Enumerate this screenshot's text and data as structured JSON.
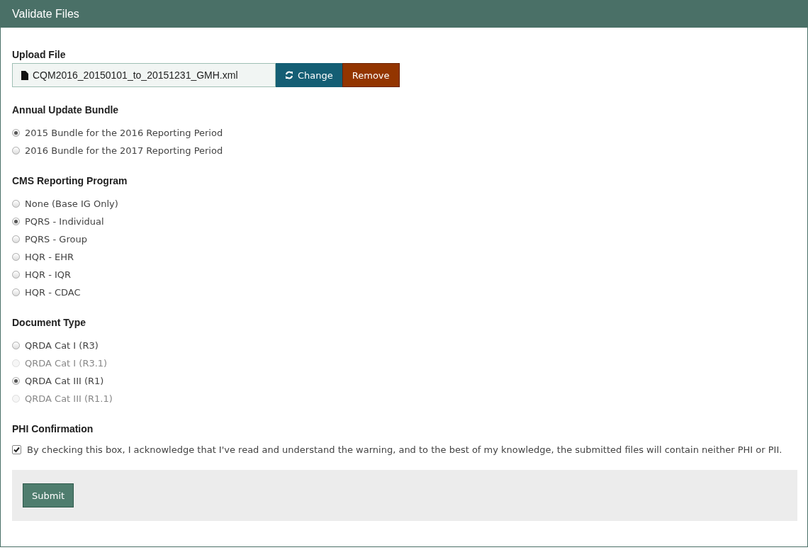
{
  "panel": {
    "title": "Validate Files"
  },
  "upload": {
    "label": "Upload File",
    "filename": "CQM2016_20150101_to_20151231_GMH.xml",
    "change_button": "Change",
    "remove_button": "Remove"
  },
  "groups": [
    {
      "label": "Annual Update Bundle",
      "options": [
        {
          "label": "2015 Bundle for the 2016 Reporting Period",
          "selected": true,
          "disabled": false
        },
        {
          "label": "2016 Bundle for the 2017 Reporting Period",
          "selected": false,
          "disabled": false
        }
      ]
    },
    {
      "label": "CMS Reporting Program",
      "options": [
        {
          "label": "None (Base IG Only)",
          "selected": false,
          "disabled": false
        },
        {
          "label": "PQRS - Individual",
          "selected": true,
          "disabled": false
        },
        {
          "label": "PQRS - Group",
          "selected": false,
          "disabled": false
        },
        {
          "label": "HQR - EHR",
          "selected": false,
          "disabled": false
        },
        {
          "label": "HQR - IQR",
          "selected": false,
          "disabled": false
        },
        {
          "label": "HQR - CDAC",
          "selected": false,
          "disabled": false
        }
      ]
    },
    {
      "label": "Document Type",
      "options": [
        {
          "label": "QRDA Cat I (R3)",
          "selected": false,
          "disabled": false
        },
        {
          "label": "QRDA Cat I (R3.1)",
          "selected": false,
          "disabled": true
        },
        {
          "label": "QRDA Cat III (R1)",
          "selected": true,
          "disabled": false
        },
        {
          "label": "QRDA Cat III (R1.1)",
          "selected": false,
          "disabled": true
        }
      ]
    }
  ],
  "phi": {
    "label": "PHI Confirmation",
    "text": "By checking this box, I acknowledge that I've read and understand the warning, and to the best of my knowledge, the submitted files will contain neither PHI or PII.",
    "checked": true
  },
  "submit_button": "Submit"
}
